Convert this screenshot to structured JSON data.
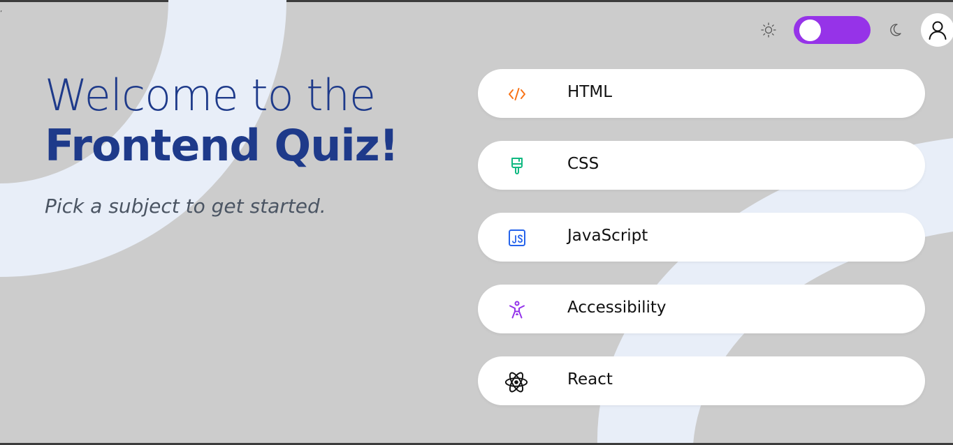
{
  "header": {
    "theme_toggle_state": "dark-active",
    "icons": {
      "light_mode": "sun-icon",
      "dark_mode": "moon-icon",
      "account": "user-icon"
    }
  },
  "hero": {
    "title_light": "Welcome to the",
    "title_bold": "Frontend Quiz!",
    "subtitle": "Pick a subject to get started."
  },
  "subjects": [
    {
      "label": "HTML",
      "icon": "code-icon",
      "color": "#f97316"
    },
    {
      "label": "CSS",
      "icon": "paintbrush-icon",
      "color": "#10b981"
    },
    {
      "label": "JavaScript",
      "icon": "js-icon",
      "color": "#2563eb"
    },
    {
      "label": "Accessibility",
      "icon": "accessibility-icon",
      "color": "#9333ea"
    },
    {
      "label": "React",
      "icon": "react-icon",
      "color": "#111111"
    }
  ],
  "colors": {
    "background": "#cccccc",
    "accent": "#9633e8",
    "heading": "#1e3a8a",
    "decoration": "#e8eef8"
  }
}
